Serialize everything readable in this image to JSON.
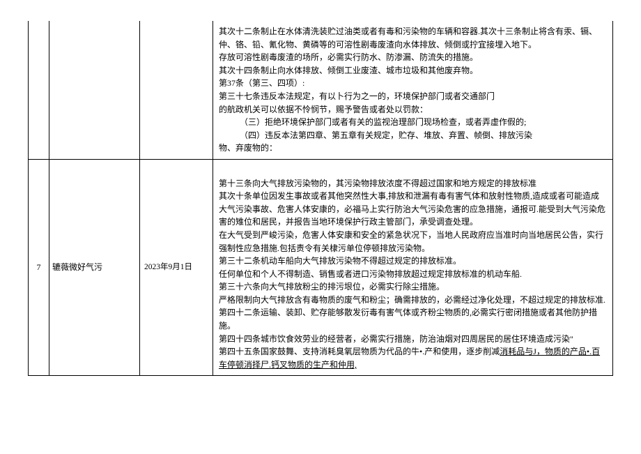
{
  "row1": {
    "paragraphs": [
      "其次十二条制止在水体清洗装贮过油类或者有毒和污染物的车辆和容器.其次十三条制止将含有汞、镉、仲、铬、铅、氰化物、黄磷等的可溶性剧毒废渣向水体排放、倾倒或拧宜接埋入地下。",
      "存放可溶性剧毒废渣的场所，必需实行防水、防渗漏、防流失的措施。",
      "其次十四条制止向水体排放、倾倒工业废渣、城市垃圾和其他废弃物。",
      "第37条（第三、四项）:",
      "第三十七条违反本法规定，有以卜行为之一的，环境保护部门或者交通部门",
      "的航政机关可以依据不怜悯节，赐予警告或者处以罚款："
    ],
    "indented": [
      "（三）拒绝环境保护部门或者有关的监视治理部门现场检查，或者弄虚作假的;",
      "（四）违反本法第四章、第五章有关规定，贮存、堆放、弃置、帧倒、排放污染"
    ],
    "last": "物、弃废物的："
  },
  "row2": {
    "num": "7",
    "name": "辘薇微好气污",
    "date": "2023年9月1日",
    "paragraphs": [
      "第十三条向大气排放污染物的，其污染物排放浓度不得超过国家和地方规定的排放标准",
      "其次十条单位因发生事故或者其他突然性大事,排放和泄漏有毒有害气体和放射性物质,造成或者可能造成大气污染事故、危害人体安康的，必福马上实行防治大气污染危害的应急措施，通报可.能受到大气污染危害的雉位和居民，并报告当地环境保护行政主管部门，承受调查处理。",
      "在大气受到严峻污染，危害人体安康和安全的紧急状况下，当地人民政府应当准时向当地居民公告，实行强制性应急措施.包括责令有关棣污单位停顿排放污染物。",
      "第三十二条机动车船向大气排放污染物不得超过规定的排放标准。",
      "任何单位和个人不得制造、销售或者进口污染物排放超过规定排放标准的机动车船.",
      "第三十六条向大气排放粉尘的排污垠位，必需实行除尘措施。",
      "严格限制向大气排放含有毒物质的废气和粉尘；确需排放的，必需经过净化处理，不超过规定的排放标准.",
      "第四十二条运输、装卸、贮存能够散发衍毒有害气体或齐粉尘物质的,必需实行密闭措施或者其他防护措施。",
      "第四十四条城市饮食效劳业的经营者，必需实行措施，防治油烟对四周居民的居住环境造成污染\""
    ],
    "last_prefix": "第四十五条国家鼓舞、支持消耗臭氧层物质为代品的牛•.产和使用，逐步削减",
    "last_underlined": "消耗品与J，物质的产品•.百车停顿消择尸.钙叉物质的生产和仲用,"
  }
}
